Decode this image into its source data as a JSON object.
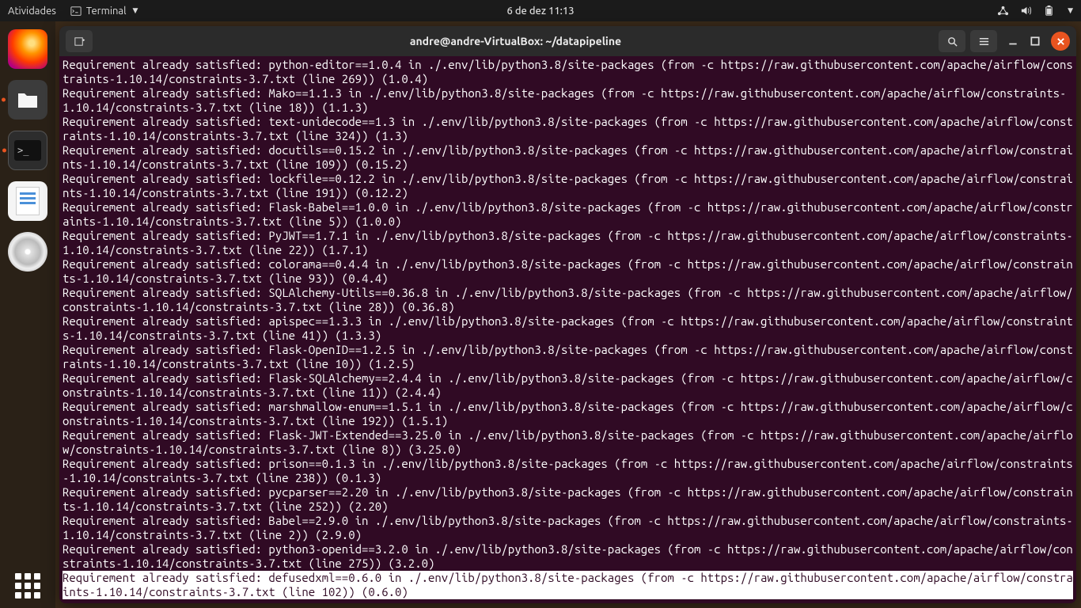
{
  "topbar": {
    "activities": "Atividades",
    "app": "Terminal",
    "clock": "6 de dez  11:13"
  },
  "window": {
    "title": "andre@andre-VirtualBox: ~/datapipeline"
  },
  "terminal_lines": [
    {
      "t": "Requirement already satisfied: python-editor==1.0.4 in ./.env/lib/python3.8/site-packages (from -c https://raw.githubusercontent.com/apache/airflow/constraints-1.10.14/constraints-3.7.txt (line 269)) (1.0.4)"
    },
    {
      "t": "Requirement already satisfied: Mako==1.1.3 in ./.env/lib/python3.8/site-packages (from -c https://raw.githubusercontent.com/apache/airflow/constraints-1.10.14/constraints-3.7.txt (line 18)) (1.1.3)"
    },
    {
      "t": "Requirement already satisfied: text-unidecode==1.3 in ./.env/lib/python3.8/site-packages (from -c https://raw.githubusercontent.com/apache/airflow/constraints-1.10.14/constraints-3.7.txt (line 324)) (1.3)"
    },
    {
      "t": "Requirement already satisfied: docutils==0.15.2 in ./.env/lib/python3.8/site-packages (from -c https://raw.githubusercontent.com/apache/airflow/constraints-1.10.14/constraints-3.7.txt (line 109)) (0.15.2)"
    },
    {
      "t": "Requirement already satisfied: lockfile==0.12.2 in ./.env/lib/python3.8/site-packages (from -c https://raw.githubusercontent.com/apache/airflow/constraints-1.10.14/constraints-3.7.txt (line 191)) (0.12.2)"
    },
    {
      "t": "Requirement already satisfied: Flask-Babel==1.0.0 in ./.env/lib/python3.8/site-packages (from -c https://raw.githubusercontent.com/apache/airflow/constraints-1.10.14/constraints-3.7.txt (line 5)) (1.0.0)"
    },
    {
      "t": "Requirement already satisfied: PyJWT==1.7.1 in ./.env/lib/python3.8/site-packages (from -c https://raw.githubusercontent.com/apache/airflow/constraints-1.10.14/constraints-3.7.txt (line 22)) (1.7.1)"
    },
    {
      "t": "Requirement already satisfied: colorama==0.4.4 in ./.env/lib/python3.8/site-packages (from -c https://raw.githubusercontent.com/apache/airflow/constraints-1.10.14/constraints-3.7.txt (line 93)) (0.4.4)"
    },
    {
      "t": "Requirement already satisfied: SQLAlchemy-Utils==0.36.8 in ./.env/lib/python3.8/site-packages (from -c https://raw.githubusercontent.com/apache/airflow/constraints-1.10.14/constraints-3.7.txt (line 28)) (0.36.8)"
    },
    {
      "t": "Requirement already satisfied: apispec==1.3.3 in ./.env/lib/python3.8/site-packages (from -c https://raw.githubusercontent.com/apache/airflow/constraints-1.10.14/constraints-3.7.txt (line 41)) (1.3.3)"
    },
    {
      "t": "Requirement already satisfied: Flask-OpenID==1.2.5 in ./.env/lib/python3.8/site-packages (from -c https://raw.githubusercontent.com/apache/airflow/constraints-1.10.14/constraints-3.7.txt (line 10)) (1.2.5)"
    },
    {
      "t": "Requirement already satisfied: Flask-SQLAlchemy==2.4.4 in ./.env/lib/python3.8/site-packages (from -c https://raw.githubusercontent.com/apache/airflow/constraints-1.10.14/constraints-3.7.txt (line 11)) (2.4.4)"
    },
    {
      "t": "Requirement already satisfied: marshmallow-enum==1.5.1 in ./.env/lib/python3.8/site-packages (from -c https://raw.githubusercontent.com/apache/airflow/constraints-1.10.14/constraints-3.7.txt (line 192)) (1.5.1)"
    },
    {
      "t": "Requirement already satisfied: Flask-JWT-Extended==3.25.0 in ./.env/lib/python3.8/site-packages (from -c https://raw.githubusercontent.com/apache/airflow/constraints-1.10.14/constraints-3.7.txt (line 8)) (3.25.0)"
    },
    {
      "t": "Requirement already satisfied: prison==0.1.3 in ./.env/lib/python3.8/site-packages (from -c https://raw.githubusercontent.com/apache/airflow/constraints-1.10.14/constraints-3.7.txt (line 238)) (0.1.3)"
    },
    {
      "t": "Requirement already satisfied: pycparser==2.20 in ./.env/lib/python3.8/site-packages (from -c https://raw.githubusercontent.com/apache/airflow/constraints-1.10.14/constraints-3.7.txt (line 252)) (2.20)"
    },
    {
      "t": "Requirement already satisfied: Babel==2.9.0 in ./.env/lib/python3.8/site-packages (from -c https://raw.githubusercontent.com/apache/airflow/constraints-1.10.14/constraints-3.7.txt (line 2)) (2.9.0)"
    },
    {
      "t": "Requirement already satisfied: python3-openid==3.2.0 in ./.env/lib/python3.8/site-packages (from -c https://raw.githubusercontent.com/apache/airflow/constraints-1.10.14/constraints-3.7.txt (line 275)) (3.2.0)"
    },
    {
      "t": "Requirement already satisfied: defusedxml==0.6.0 in ./.env/lib/python3.8/site-packages (from -c https://raw.githubusercontent.com/apache/airflow/constraints-1.10.14/constraints-3.7.txt (line 102)) (0.6.0)",
      "hl": true
    }
  ]
}
